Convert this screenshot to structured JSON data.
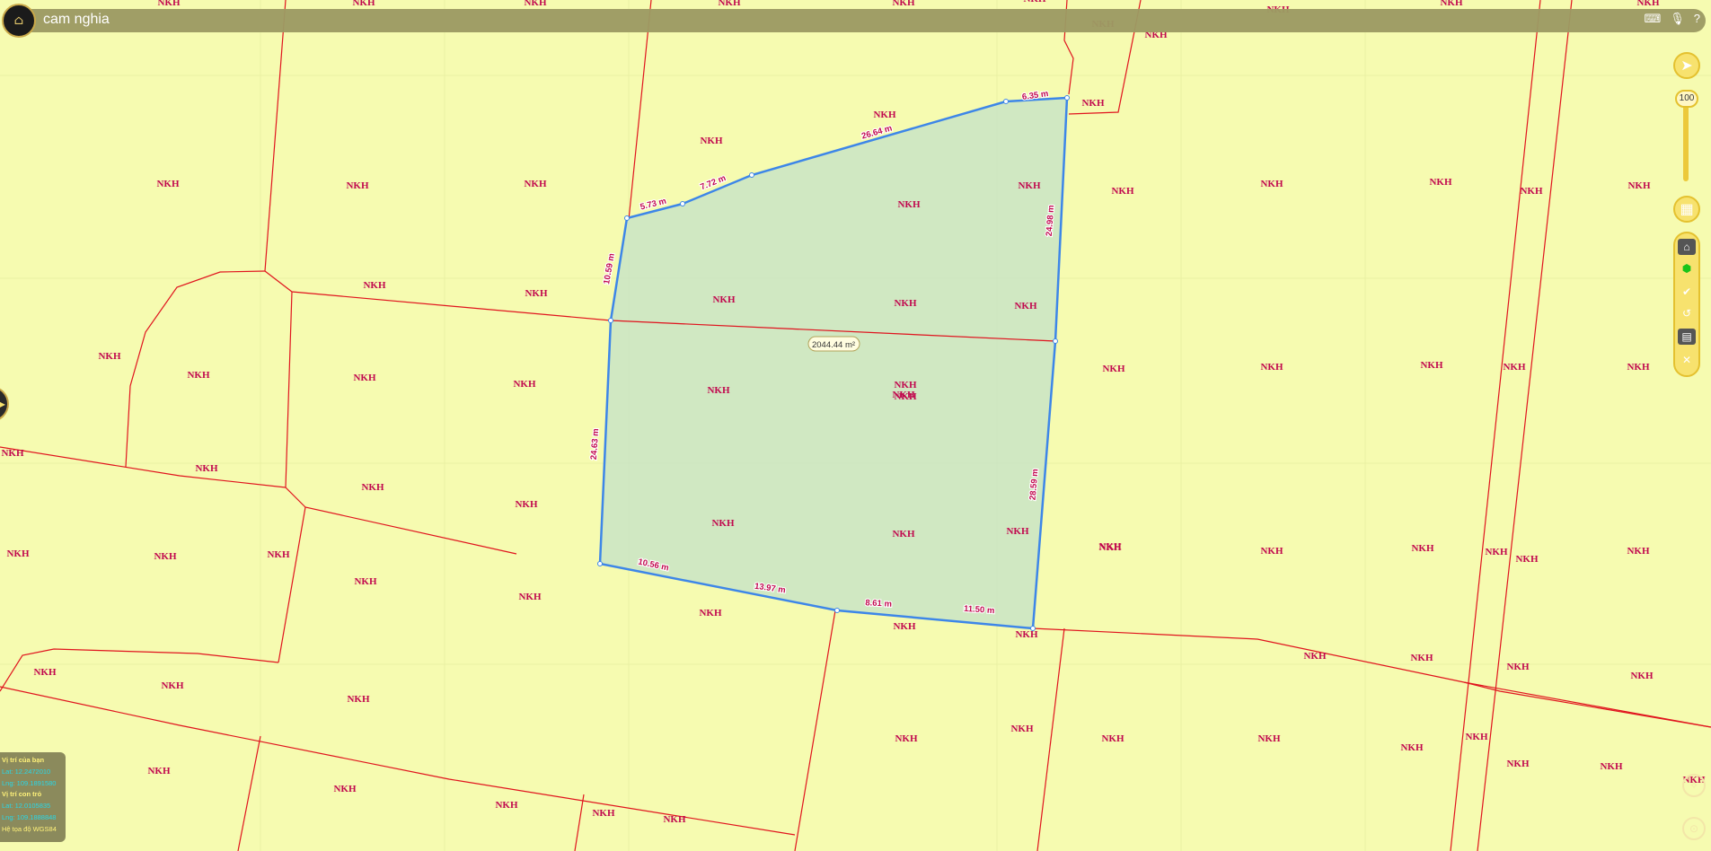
{
  "app": {
    "title": "cam nghia",
    "logo_icon": "app-logo-icon"
  },
  "top_icons": [
    "keyboard-icon",
    "microphone-icon",
    "help-icon"
  ],
  "controls": {
    "zoom_value": "100",
    "zoom_fraction": 1.0
  },
  "tools": [
    "layers-icon",
    "polygon-icon",
    "check-icon",
    "undo-icon",
    "calculator-icon",
    "close-icon"
  ],
  "parcel_label": "NKH",
  "area_label": "2044.44 m²",
  "edge_labels": [
    "6.35 m",
    "26.64 m",
    "7.72 m",
    "5.73 m",
    "10.59 m",
    "24.63 m",
    "10.56 m",
    "13.97 m",
    "8.61 m",
    "11.50 m",
    "28.59 m",
    "24.98 m"
  ],
  "info_panel": {
    "your_position_title": "Vị trí của bạn",
    "your_lat": "Lat: 12.2472010",
    "your_lng": "Lng: 109.1891580",
    "pointer_title": "Vị trí con trỏ",
    "pointer_lat": "Lat: 12.0105835",
    "pointer_lng": "Lng: 109.1888848",
    "coord_system": "Hệ tọa độ WGS84"
  },
  "colors": {
    "map_bg": "#f6fbb0",
    "parcel_line": "#e0141e",
    "label": "#c1084e",
    "selection_fill": "#c9e4c6",
    "selection_stroke": "#3d86e8"
  }
}
